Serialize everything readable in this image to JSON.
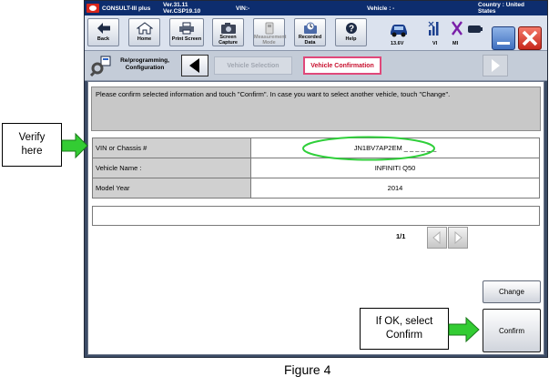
{
  "titlebar": {
    "app_name": "CONSULT-III plus",
    "version_line1": "Ver.31.11",
    "version_line2": "Ver.CSP19.10",
    "vin_label": "VIN:-",
    "vehicle_label": "Vehicle : -",
    "country_line1": "Country : United",
    "country_line2": "States"
  },
  "toolbar": {
    "back": "Back",
    "home": "Home",
    "print_screen": "Print Screen",
    "screen_capture_1": "Screen",
    "screen_capture_2": "Capture",
    "measurement_1": "Measurement",
    "measurement_2": "Mode",
    "recorded_1": "Recorded",
    "recorded_2": "Data",
    "help": "Help"
  },
  "status": {
    "battery": "13.6V",
    "vi": "VI",
    "mi": "MI"
  },
  "navbar": {
    "reprog_line1": "Re/programming,",
    "reprog_line2": "Configuration",
    "step_vehicle_selection": "Vehicle Selection",
    "step_vehicle_confirmation": "Vehicle Confirmation"
  },
  "content": {
    "message": "Please confirm selected information and touch \"Confirm\". In case you want to select another vehicle, touch \"Change\".",
    "rows": [
      {
        "label": "VIN or Chassis #",
        "value": "JN1BV7AP2EM _ _ _ _ _ _"
      },
      {
        "label": "Vehicle Name :",
        "value": "INFINITI Q50"
      },
      {
        "label": "Model Year",
        "value": "2014"
      }
    ],
    "page_indicator": "1/1",
    "change_button": "Change",
    "confirm_button": "Confirm"
  },
  "annotations": {
    "verify_line1": "Verify",
    "verify_line2": "here",
    "ok_line1": "If OK, select",
    "ok_line2": "Confirm",
    "figure_caption": "Figure 4"
  },
  "colors": {
    "highlight_ellipse": "#2fcf3a",
    "callout_arrow": "#33cc33",
    "active_step_border": "#e0487a",
    "active_step_text": "#c8102e"
  }
}
